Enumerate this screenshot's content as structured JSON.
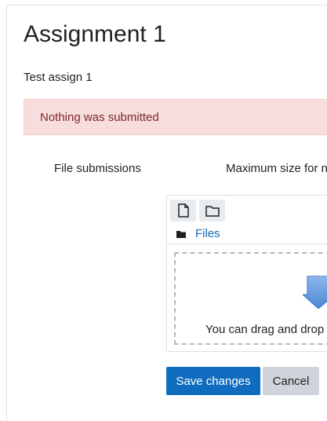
{
  "page": {
    "title": "Assignment 1",
    "intro": "Test assign 1"
  },
  "alert": {
    "text": "Nothing was submitted"
  },
  "form": {
    "file_submissions_label": "File submissions",
    "max_size_label": "Maximum size for n"
  },
  "filemanager": {
    "toolbar": [
      {
        "icon": "file-icon"
      },
      {
        "icon": "folder-icon"
      }
    ],
    "path_label": "Files",
    "dropzone_text": "You can drag and drop f"
  },
  "buttons": {
    "save": "Save changes",
    "cancel": "Cancel"
  },
  "colors": {
    "primary": "#0f6cbf",
    "alert_bg": "#f7dddc",
    "alert_text": "#7d2a2a",
    "secondary_button": "#ced4da"
  }
}
